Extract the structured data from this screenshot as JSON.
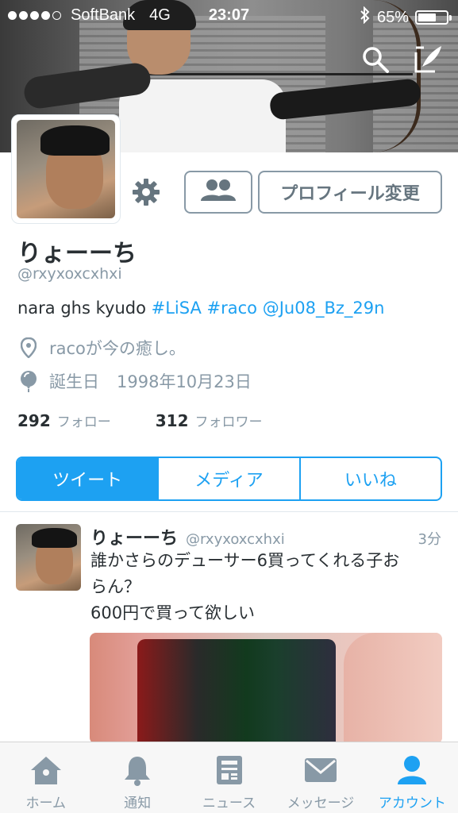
{
  "status_bar": {
    "carrier": "SoftBank",
    "network": "4G",
    "time": "23:07",
    "battery": "65%",
    "signal_bars_filled": 4,
    "signal_bars_total": 5,
    "battery_level": 0.65
  },
  "header_actions": {
    "search_icon": "search-icon",
    "compose_icon": "compose-icon"
  },
  "profile": {
    "name": "りょーーち",
    "handle": "@rxyxoxcxhxi",
    "bio_plain": "nara ghs kyudo ",
    "bio_hashtag1": "#LiSA",
    "bio_hashtag2": "#raco",
    "bio_mention": "@Ju08_Bz_29n",
    "location": "racoが今の癒し。",
    "birthday_label": "誕生日",
    "birthday_value": "1998年10月23日",
    "following_count": "292",
    "following_label": "フォロー",
    "followers_count": "312",
    "followers_label": "フォロワー",
    "edit_profile_label": "プロフィール変更"
  },
  "tabs": [
    {
      "label": "ツイート",
      "active": true
    },
    {
      "label": "メディア",
      "active": false
    },
    {
      "label": "いいね",
      "active": false
    }
  ],
  "tweet": {
    "name": "りょーーち",
    "handle": "@rxyxoxcxhxi",
    "time": "3分",
    "line1": "誰かさらのデューサー6買ってくれる子お",
    "line2": "らん？",
    "line3": "600円で買って欲しい"
  },
  "bottom_nav": [
    {
      "label": "ホーム",
      "icon": "home-icon",
      "active": false
    },
    {
      "label": "通知",
      "icon": "bell-icon",
      "active": false
    },
    {
      "label": "ニュース",
      "icon": "news-icon",
      "active": false
    },
    {
      "label": "メッセージ",
      "icon": "envelope-icon",
      "active": false
    },
    {
      "label": "アカウント",
      "icon": "person-icon",
      "active": true
    }
  ],
  "colors": {
    "accent": "#1da1f2",
    "muted": "#8899a6",
    "text": "#292f33"
  }
}
